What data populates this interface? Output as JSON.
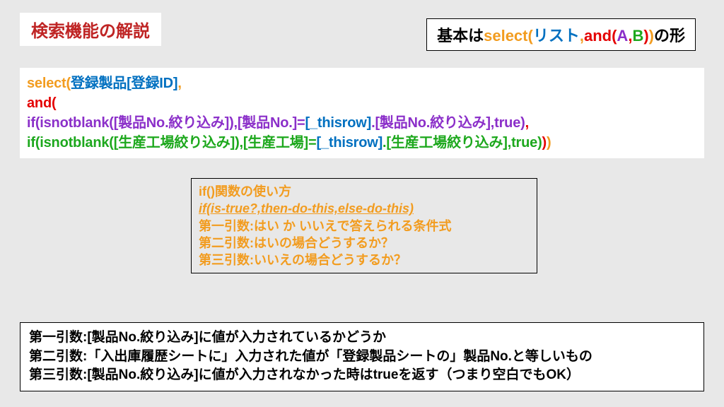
{
  "title": "検索機能の解説",
  "pattern": {
    "prefix": "基本は",
    "select": "select(",
    "list": "リスト",
    "comma1": ",",
    "and": "and(",
    "A": "A",
    "comma2": ",",
    "B": "B",
    "close1": ")",
    "close2": ")",
    "suffix": "の形"
  },
  "code": {
    "l1_select": "select(",
    "l1_arg": "登録製品[登録ID]",
    "l1_comma": ",",
    "l2_and": "and(",
    "l3_a": "if(isnotblank([製品No.絞り込み]),[製品No.]=",
    "l3_thisrow": "[_thisrow]",
    "l3_b": ".[製品No.絞り込み],true)",
    "l3_comma": ",",
    "l4_a": "if(isnotblank([生産工場絞り込み]),[生産工場]=",
    "l4_thisrow": "[_thisrow]",
    "l4_b": ".[生産工場絞り込み],true)",
    "l4_close_and": ")",
    "l4_close_sel": ")"
  },
  "usage": {
    "l1": "if()関数の使い方",
    "l2": "if(is-true?,then-do-this,else-do-this)",
    "l3": "第一引数:はい か いいえで答えられる条件式",
    "l4": "第二引数:はいの場合どうするか？",
    "l5": "第三引数:いいえの場合どうするか？"
  },
  "args": {
    "l1": "第一引数:[製品No.絞り込み]に値が入力されているかどうか",
    "l2": "第二引数:「入出庫履歴シートに」入力された値が「登録製品シートの」製品No.と等しいもの",
    "l3": "第三引数:[製品No.絞り込み]に値が入力されなかった時はtrueを返す（つまり空白でもOK）"
  }
}
